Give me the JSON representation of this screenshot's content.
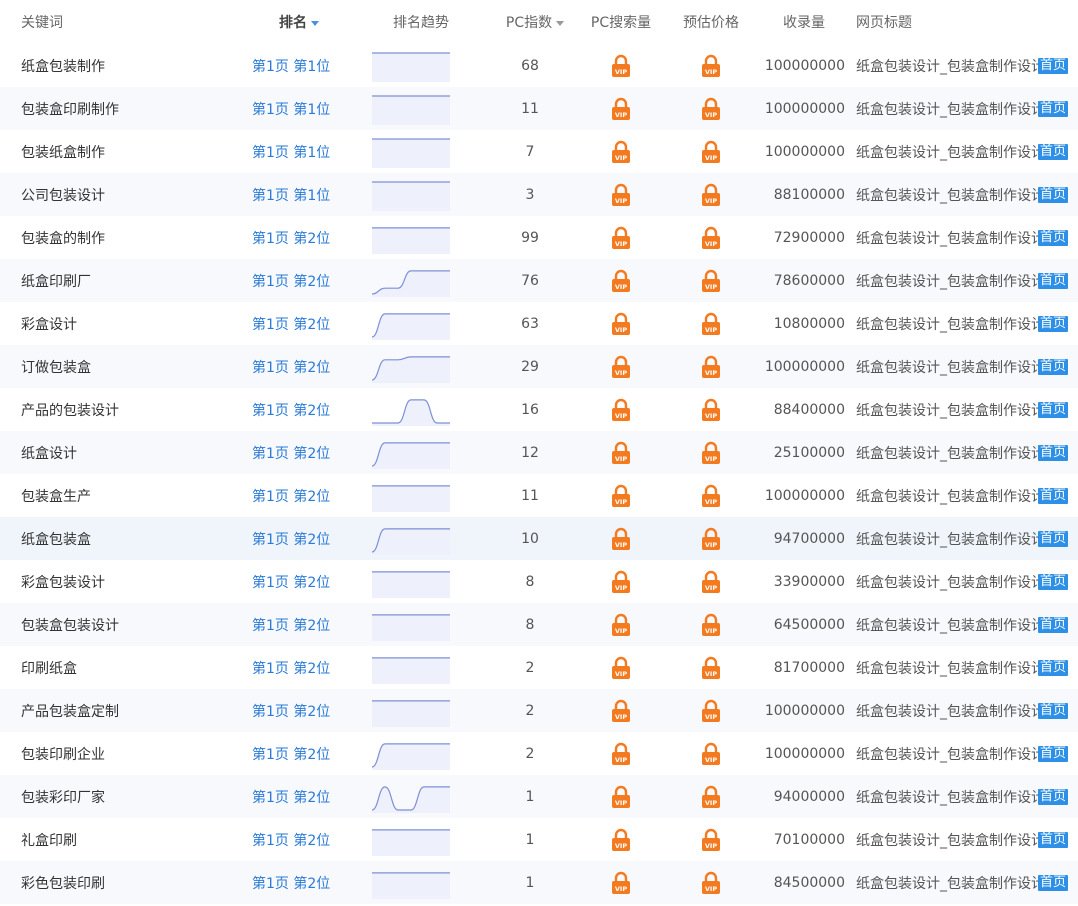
{
  "header": {
    "keyword": "关键词",
    "rank": "排名",
    "trend": "排名趋势",
    "pc_index": "PC指数",
    "pc_volume": "PC搜索量",
    "price": "预估价格",
    "indexed": "收录量",
    "page_title": "网页标题"
  },
  "icons": {
    "locked": "vip-lock-icon",
    "sort": "sort-down-icon"
  },
  "colors": {
    "link": "#2a7ad6",
    "badge": "#2d8fe6",
    "vip": "#f47a20",
    "spark": "#7f8fd6"
  },
  "rows": [
    {
      "keyword": "纸盒包装制作",
      "rank": "第1页 第1位",
      "trend": [
        1,
        1,
        1,
        1,
        1,
        1,
        1
      ],
      "pc_index": "68",
      "indexed": "100000000",
      "title": "纸盒包装设计_包装盒制作设计",
      "home": "首页"
    },
    {
      "keyword": "包装盒印刷制作",
      "rank": "第1页 第1位",
      "trend": [
        1,
        1,
        1,
        1,
        1,
        1,
        1
      ],
      "pc_index": "11",
      "indexed": "100000000",
      "title": "纸盒包装设计_包装盒制作设计",
      "home": "首页"
    },
    {
      "keyword": "包装纸盒制作",
      "rank": "第1页 第1位",
      "trend": [
        1,
        1,
        1,
        1,
        1,
        1,
        1
      ],
      "pc_index": "7",
      "indexed": "100000000",
      "title": "纸盒包装设计_包装盒制作设计",
      "home": "首页"
    },
    {
      "keyword": "公司包装设计",
      "rank": "第1页 第1位",
      "trend": [
        1,
        1,
        1,
        1,
        1,
        1,
        1
      ],
      "pc_index": "3",
      "indexed": "88100000",
      "title": "纸盒包装设计_包装盒制作设计",
      "home": "首页"
    },
    {
      "keyword": "包装盒的制作",
      "rank": "第1页 第2位",
      "trend": [
        2,
        2,
        2,
        2,
        2,
        2,
        2
      ],
      "pc_index": "99",
      "indexed": "72900000",
      "title": "纸盒包装设计_包装盒制作设计",
      "home": "首页"
    },
    {
      "keyword": "纸盒印刷厂",
      "rank": "第1页 第2位",
      "trend": [
        10,
        8,
        8,
        2,
        2,
        2,
        2
      ],
      "pc_index": "76",
      "indexed": "78600000",
      "title": "纸盒包装设计_包装盒制作设计",
      "home": "首页"
    },
    {
      "keyword": "彩盒设计",
      "rank": "第1页 第2位",
      "trend": [
        10,
        2,
        2,
        2,
        2,
        2,
        2
      ],
      "pc_index": "63",
      "indexed": "10800000",
      "title": "纸盒包装设计_包装盒制作设计",
      "home": "首页"
    },
    {
      "keyword": "订做包装盒",
      "rank": "第1页 第2位",
      "trend": [
        10,
        3,
        3,
        2,
        2,
        2,
        2
      ],
      "pc_index": "29",
      "indexed": "100000000",
      "title": "纸盒包装设计_包装盒制作设计",
      "home": "首页"
    },
    {
      "keyword": "产品的包装设计",
      "rank": "第1页 第2位",
      "trend": [
        10,
        10,
        10,
        2,
        2,
        10,
        10
      ],
      "pc_index": "16",
      "indexed": "88400000",
      "title": "纸盒包装设计_包装盒制作设计",
      "home": "首页"
    },
    {
      "keyword": "纸盒设计",
      "rank": "第1页 第2位",
      "trend": [
        10,
        2,
        2,
        2,
        2,
        2,
        2
      ],
      "pc_index": "12",
      "indexed": "25100000",
      "title": "纸盒包装设计_包装盒制作设计",
      "home": "首页"
    },
    {
      "keyword": "包装盒生产",
      "rank": "第1页 第2位",
      "trend": [
        2,
        2,
        2,
        2,
        2,
        2,
        2
      ],
      "pc_index": "11",
      "indexed": "100000000",
      "title": "纸盒包装设计_包装盒制作设计",
      "home": "首页"
    },
    {
      "keyword": "纸盒包装盒",
      "rank": "第1页 第2位",
      "trend": [
        10,
        2,
        2,
        2,
        2,
        2,
        2
      ],
      "pc_index": "10",
      "indexed": "94700000",
      "title": "纸盒包装设计_包装盒制作设计",
      "home": "首页"
    },
    {
      "keyword": "彩盒包装设计",
      "rank": "第1页 第2位",
      "trend": [
        2,
        2,
        2,
        2,
        2,
        2,
        2
      ],
      "pc_index": "8",
      "indexed": "33900000",
      "title": "纸盒包装设计_包装盒制作设计",
      "home": "首页"
    },
    {
      "keyword": "包装盒包装设计",
      "rank": "第1页 第2位",
      "trend": [
        2,
        2,
        2,
        2,
        2,
        2,
        2
      ],
      "pc_index": "8",
      "indexed": "64500000",
      "title": "纸盒包装设计_包装盒制作设计",
      "home": "首页"
    },
    {
      "keyword": "印刷纸盒",
      "rank": "第1页 第2位",
      "trend": [
        2,
        2,
        2,
        2,
        2,
        2,
        2
      ],
      "pc_index": "2",
      "indexed": "81700000",
      "title": "纸盒包装设计_包装盒制作设计",
      "home": "首页"
    },
    {
      "keyword": "产品包装盒定制",
      "rank": "第1页 第2位",
      "trend": [
        2,
        2,
        2,
        2,
        2,
        2,
        2
      ],
      "pc_index": "2",
      "indexed": "100000000",
      "title": "纸盒包装设计_包装盒制作设计",
      "home": "首页"
    },
    {
      "keyword": "包装印刷企业",
      "rank": "第1页 第2位",
      "trend": [
        10,
        2,
        2,
        2,
        2,
        2,
        2
      ],
      "pc_index": "2",
      "indexed": "100000000",
      "title": "纸盒包装设计_包装盒制作设计",
      "home": "首页"
    },
    {
      "keyword": "包装彩印厂家",
      "rank": "第1页 第2位",
      "trend": [
        10,
        2,
        10,
        10,
        2,
        2,
        2
      ],
      "pc_index": "1",
      "indexed": "94000000",
      "title": "纸盒包装设计_包装盒制作设计",
      "home": "首页"
    },
    {
      "keyword": "礼盒印刷",
      "rank": "第1页 第2位",
      "trend": [
        2,
        2,
        2,
        2,
        2,
        2,
        2
      ],
      "pc_index": "1",
      "indexed": "70100000",
      "title": "纸盒包装设计_包装盒制作设计",
      "home": "首页"
    },
    {
      "keyword": "彩色包装印刷",
      "rank": "第1页 第2位",
      "trend": [
        2,
        2,
        2,
        2,
        2,
        2,
        2
      ],
      "pc_index": "1",
      "indexed": "84500000",
      "title": "纸盒包装设计_包装盒制作设计",
      "home": "首页"
    }
  ]
}
